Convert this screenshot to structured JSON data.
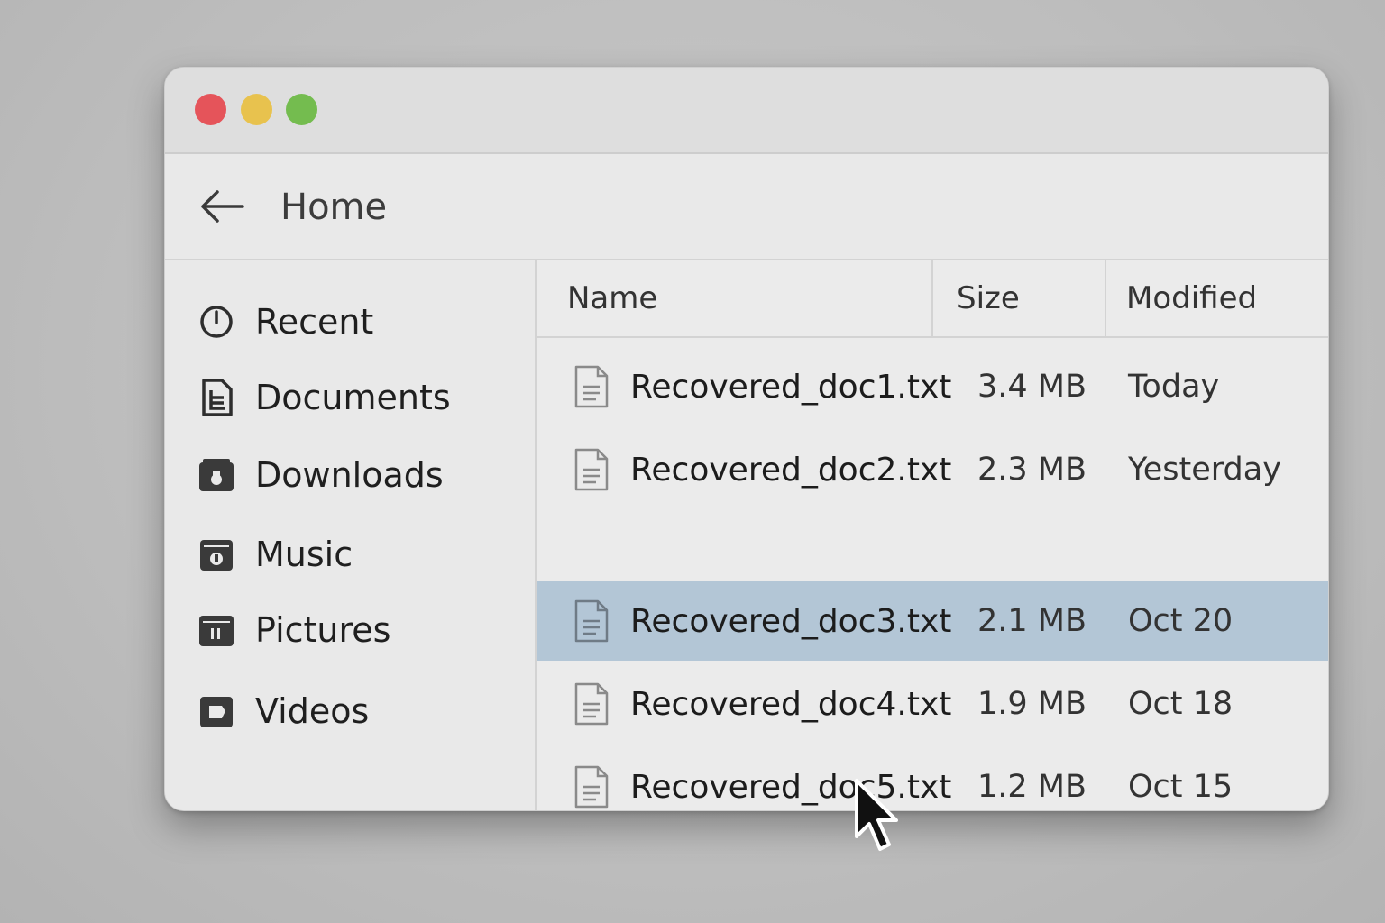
{
  "window": {
    "traffic_colors": {
      "close": "#e5545a",
      "minimize": "#e8c24e",
      "maximize": "#74bc4f"
    }
  },
  "toolbar": {
    "back_icon": "arrow-left-icon",
    "title": "Home"
  },
  "sidebar": {
    "items": [
      {
        "label": "Recent",
        "icon": "clock-icon"
      },
      {
        "label": "Documents",
        "icon": "document-icon"
      },
      {
        "label": "Downloads",
        "icon": "download-folder-icon"
      },
      {
        "label": "Music",
        "icon": "music-folder-icon"
      },
      {
        "label": "Pictures",
        "icon": "pictures-folder-icon"
      },
      {
        "label": "Videos",
        "icon": "video-folder-icon"
      }
    ]
  },
  "file_list": {
    "columns": {
      "name": "Name",
      "size": "Size",
      "modified": "Modified"
    },
    "rows": [
      {
        "name": "Recovered_doc1.txt",
        "size": "3.4 MB",
        "modified": "Today",
        "selected": false
      },
      {
        "name": "Recovered_doc2.txt",
        "size": "2.3 MB",
        "modified": "Yesterday",
        "selected": false
      },
      {
        "name": "Recovered_doc3.txt",
        "size": "2.1 MB",
        "modified": "Oct 20",
        "selected": true
      },
      {
        "name": "Recovered_doc4.txt",
        "size": "1.9 MB",
        "modified": "Oct 18",
        "selected": false
      },
      {
        "name": "Recovered_doc5.txt",
        "size": "1.2 MB",
        "modified": "Oct 15",
        "selected": false
      }
    ],
    "selection_color": "#b3c6d6"
  },
  "cursor": {
    "icon": "mouse-pointer-icon"
  }
}
